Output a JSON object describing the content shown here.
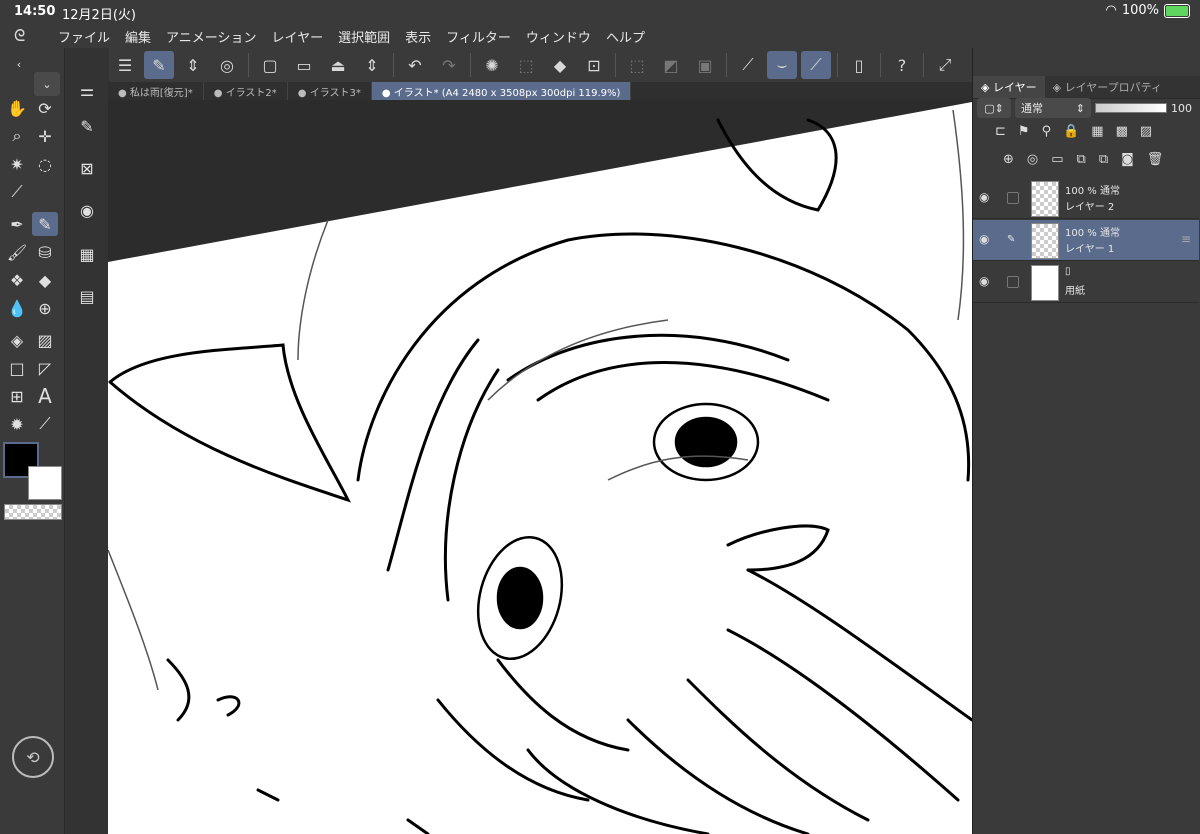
{
  "status": {
    "time": "14:50",
    "date": "12月2日(火)",
    "battery": "100%"
  },
  "menu": [
    "ファイル",
    "編集",
    "アニメーション",
    "レイヤー",
    "選択範囲",
    "表示",
    "フィルター",
    "ウィンドウ",
    "ヘルプ"
  ],
  "tabs": [
    "私は雨[復元]*",
    "イラスト2*",
    "イラスト3*",
    "イラスト* (A4 2480 x 3508px 300dpi 119.9%)"
  ],
  "panel": {
    "tab_layer": "レイヤー",
    "tab_layer_props": "レイヤープロパティ",
    "blend_mode": "通常",
    "opacity": "100"
  },
  "layers": [
    {
      "line1": "100 % 通常",
      "line2": "レイヤー 2",
      "selected": false
    },
    {
      "line1": "100 % 通常",
      "line2": "レイヤー 1",
      "selected": true
    },
    {
      "line1": "",
      "line2": "用紙",
      "selected": false
    }
  ],
  "colors": {
    "accent": "#5a6b8c",
    "main_color": "#000000",
    "sub_color": "#ffffff"
  }
}
